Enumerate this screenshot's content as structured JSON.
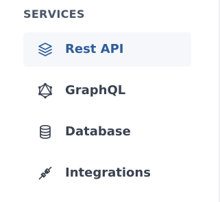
{
  "sidebar": {
    "section_title": "SERVICES",
    "items": [
      {
        "label": "Rest API",
        "icon": "layers-icon",
        "active": true
      },
      {
        "label": "GraphQL",
        "icon": "graphql-icon",
        "active": false
      },
      {
        "label": "Database",
        "icon": "database-icon",
        "active": false
      },
      {
        "label": "Integrations",
        "icon": "plug-icon",
        "active": false
      }
    ]
  },
  "colors": {
    "active_text": "#2e5d99",
    "text": "#3a4150",
    "section_title": "#4a5568",
    "active_background": "#f5f7fa"
  }
}
